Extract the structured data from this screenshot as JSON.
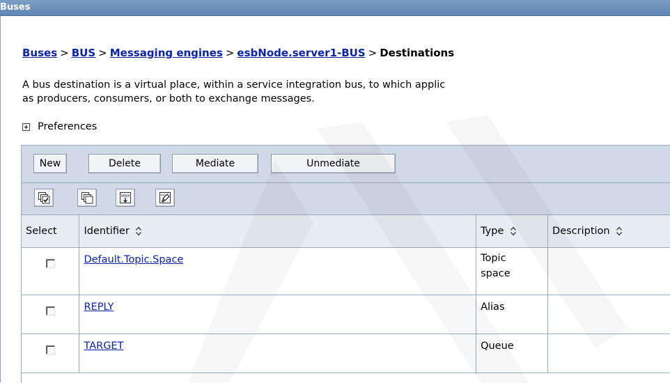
{
  "titlebar": {
    "title": "Buses"
  },
  "breadcrumb": {
    "links": [
      "Buses",
      "BUS",
      "Messaging engines",
      "esbNode.server1-BUS"
    ],
    "separator": ">",
    "current": "Destinations"
  },
  "description": {
    "line1": "A bus destination is a virtual place, within a service integration bus, to which applic",
    "line2": "as producers, consumers, or both to exchange messages."
  },
  "preferences": {
    "label": "Preferences"
  },
  "buttons": {
    "new": "New",
    "delete": "Delete",
    "mediate": "Mediate",
    "unmediate": "Unmediate"
  },
  "icons": [
    "select-all-icon",
    "deselect-all-icon",
    "show-filter-icon",
    "clear-filter-icon"
  ],
  "table": {
    "headers": {
      "select": "Select",
      "identifier": "Identifier",
      "type": "Type",
      "description": "Description"
    },
    "rows": [
      {
        "identifier": "Default.Topic.Space",
        "type_line1": "Topic",
        "type_line2": "space",
        "description": ""
      },
      {
        "identifier": "REPLY",
        "type_line1": "Alias",
        "type_line2": "",
        "description": ""
      },
      {
        "identifier": "TARGET",
        "type_line1": "Queue",
        "type_line2": "",
        "description": ""
      }
    ]
  },
  "colors": {
    "title_bar": "#6a8fbd",
    "link": "#0a24a8",
    "toolbar_bg": "#d0d9e6",
    "header_bg": "#e8edf3"
  }
}
